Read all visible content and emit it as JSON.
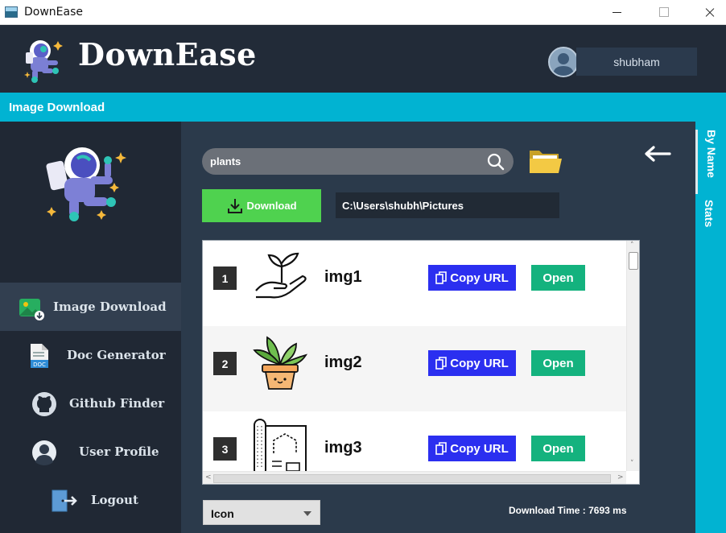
{
  "window": {
    "title": "DownEase",
    "controls": [
      "minimize",
      "maximize",
      "close"
    ]
  },
  "header": {
    "brand": "DownEase",
    "user": {
      "name": "shubham"
    }
  },
  "section": {
    "title": "Image Download"
  },
  "sidebar": {
    "items": [
      {
        "label": "Image Download",
        "icon": "image-download-icon",
        "active": true
      },
      {
        "label": "Doc  Generator",
        "icon": "doc-icon",
        "active": false
      },
      {
        "label": "Github  Finder",
        "icon": "github-icon",
        "active": false
      },
      {
        "label": "User  Profile",
        "icon": "user-icon",
        "active": false
      },
      {
        "label": "Logout",
        "icon": "logout-icon",
        "active": false
      }
    ]
  },
  "right_tabs": [
    {
      "label": "By Name",
      "active": true
    },
    {
      "label": "Stats",
      "active": false
    }
  ],
  "search": {
    "value": "plants"
  },
  "download": {
    "label": "Download"
  },
  "path": {
    "value": "C:\\Users\\shubh\\Pictures"
  },
  "results": [
    {
      "index": "1",
      "name": "img1",
      "thumb": "hand-sprout-icon",
      "copy_label": "Copy URL",
      "open_label": "Open"
    },
    {
      "index": "2",
      "name": "img2",
      "thumb": "potted-plant-icon",
      "copy_label": "Copy URL",
      "open_label": "Open"
    },
    {
      "index": "3",
      "name": "img3",
      "thumb": "greenhouse-blueprint-icon",
      "copy_label": "Copy URL",
      "open_label": "Open"
    }
  ],
  "format_select": {
    "selected": "Icon"
  },
  "status": {
    "download_time": "Download Time : 7693 ms"
  },
  "colors": {
    "accent": "#01b3d2",
    "header_bg": "#222b38",
    "sidebar_bg": "#202834",
    "content_bg": "#2b3a4b",
    "download_btn": "#4fd24f",
    "copy_btn": "#2b2ff0",
    "open_btn": "#14b27e"
  }
}
